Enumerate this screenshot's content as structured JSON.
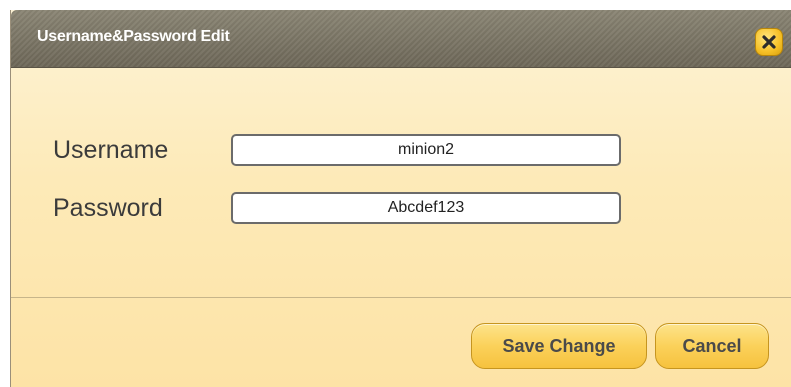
{
  "dialog": {
    "title": "Username&Password Edit",
    "close_icon": "close-x-icon"
  },
  "form": {
    "username": {
      "label": "Username",
      "value": "minion2"
    },
    "password": {
      "label": "Password",
      "value": "Abcdef123"
    }
  },
  "buttons": {
    "save_label": "Save Change",
    "cancel_label": "Cancel"
  },
  "colors": {
    "titlebar": "#6d6758",
    "body": "#fdeab8",
    "button": "#fbd15a",
    "close_button": "#f6c026"
  }
}
